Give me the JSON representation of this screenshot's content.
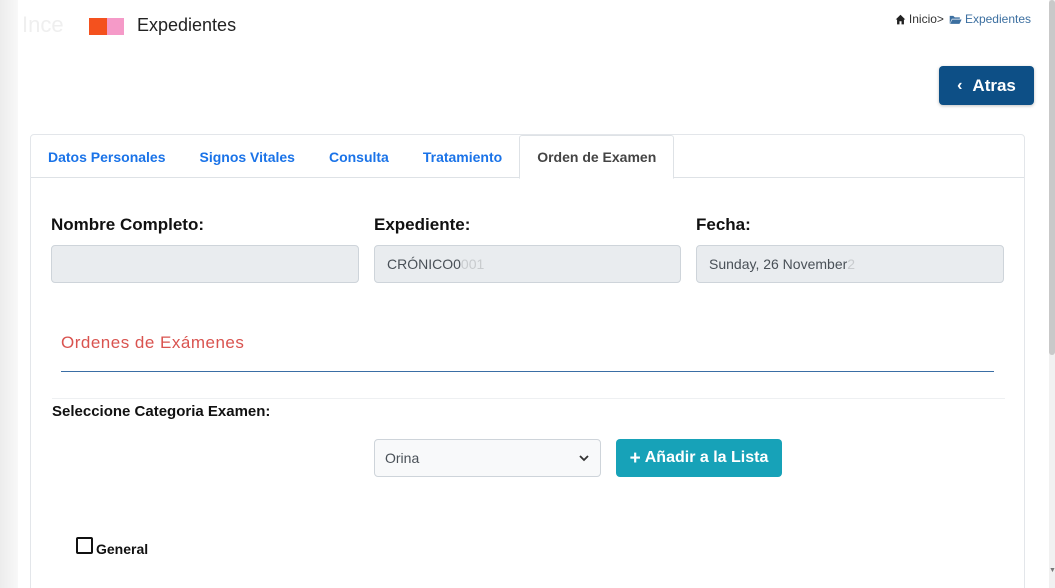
{
  "header": {
    "logo_colors": [
      "#f4511e",
      "#f59ac8"
    ],
    "ghost_text": "Ince",
    "title": "Expedientes"
  },
  "breadcrumb": {
    "home_label": "Inicio>",
    "current_label": "Expedientes"
  },
  "toolbar": {
    "back_label": "Atras"
  },
  "tabs": [
    {
      "label": "Datos Personales",
      "active": false
    },
    {
      "label": "Signos Vitales",
      "active": false
    },
    {
      "label": "Consulta",
      "active": false
    },
    {
      "label": "Tratamiento",
      "active": false
    },
    {
      "label": "Orden de Examen",
      "active": true
    }
  ],
  "patient": {
    "name_label": "Nombre Completo:",
    "name_value": "",
    "record_label": "Expediente:",
    "record_value": "CRÓNICO0",
    "record_value_faded": "001",
    "date_label": "Fecha:",
    "date_value": "Sunday, 26 November ",
    "date_value_faded": "2"
  },
  "orders": {
    "section_title": "Ordenes de Exámenes",
    "select_label": "Seleccione Categoria Examen:",
    "selected_category": "Orina",
    "add_button_label": "Añadir a la Lista"
  },
  "checkboxes": [
    {
      "label": "General",
      "checked": false
    }
  ],
  "colors": {
    "primary_button": "#0d4f86",
    "info_button": "#17a2b8",
    "tab_link": "#1a73e8",
    "section_title": "#d9534f"
  }
}
